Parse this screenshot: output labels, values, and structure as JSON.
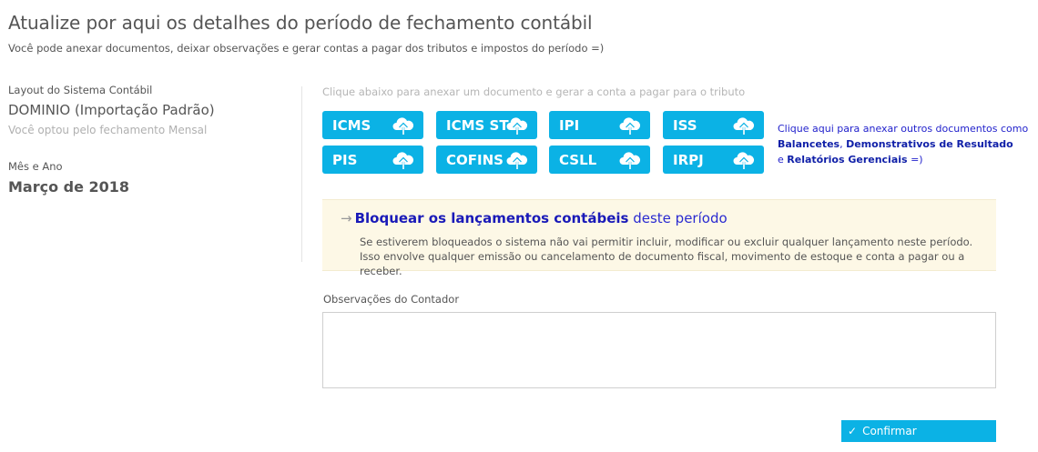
{
  "header": {
    "title": "Atualize por aqui os detalhes do período de fechamento contábil",
    "subtitle": "Você pode anexar documentos, deixar observações e gerar contas a pagar dos tributos e impostos do período =)"
  },
  "left": {
    "layout_label": "Layout do Sistema Contábil",
    "layout_value": "DOMINIO (Importação Padrão)",
    "closing_note": "Você optou pelo fechamento Mensal",
    "month_label": "Mês e Ano",
    "month_value": "Março de 2018"
  },
  "attach_hint": "Clique abaixo para anexar um documento e gerar a conta a pagar para o tributo",
  "taxes": [
    {
      "label": "ICMS",
      "icon": "cloud-upload-icon"
    },
    {
      "label": "ICMS ST",
      "icon": "cloud-upload-icon"
    },
    {
      "label": "IPI",
      "icon": "cloud-upload-icon"
    },
    {
      "label": "ISS",
      "icon": "cloud-upload-icon"
    },
    {
      "label": "PIS",
      "icon": "cloud-upload-icon"
    },
    {
      "label": "COFINS",
      "icon": "cloud-upload-icon"
    },
    {
      "label": "CSLL",
      "icon": "cloud-upload-icon"
    },
    {
      "label": "IRPJ",
      "icon": "cloud-upload-icon"
    }
  ],
  "side_note": {
    "prefix": "Clique aqui para anexar outros documentos como ",
    "balancetes": "Balancetes",
    "comma": ", ",
    "demonstrativos": "Demonstrativos de Resultado",
    "and": " e ",
    "relatorios": "Relatórios Gerenciais",
    "suffix": " =)"
  },
  "lock": {
    "arrow_icon": "arrow-right-icon",
    "title_bold": "Bloquear os lançamentos contábeis",
    "title_rest": " deste período",
    "desc_line1": "Se estiverem bloqueados o sistema não vai permitir incluir, modificar ou excluir qualquer lançamento neste período.",
    "desc_line2": "Isso envolve qualquer emissão ou cancelamento de documento fiscal, movimento de estoque e conta a pagar ou a receber."
  },
  "observations": {
    "label": "Observações do Contador",
    "value": ""
  },
  "confirm": {
    "label": "Confirmar",
    "icon": "check-icon"
  },
  "colors": {
    "accent": "#0bb2e5",
    "link": "#1a1ab8",
    "notice_bg": "#fdf8e6"
  }
}
